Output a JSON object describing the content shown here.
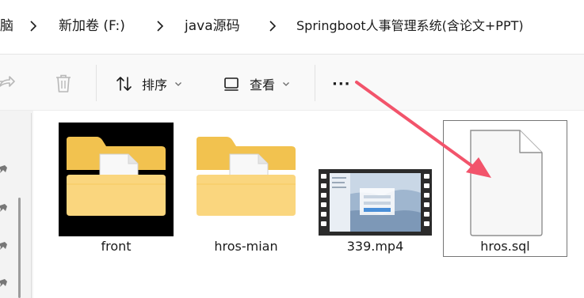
{
  "breadcrumb": {
    "items": [
      {
        "label": "脑"
      },
      {
        "label": "新加卷 (F:)"
      },
      {
        "label": "java源码"
      },
      {
        "label": "Springboot人事管理系统(含论文+PPT)"
      }
    ]
  },
  "toolbar": {
    "sort_label": "排序",
    "view_label": "查看",
    "more_label": "···"
  },
  "files": [
    {
      "name": "front",
      "type": "folder",
      "icon": "folder-icon"
    },
    {
      "name": "hros-mian",
      "type": "folder",
      "icon": "folder-icon"
    },
    {
      "name": "339.mp4",
      "type": "video",
      "icon": "video-thumbnail-icon"
    },
    {
      "name": "hros.sql",
      "type": "file",
      "icon": "file-icon",
      "selected": true
    }
  ],
  "colors": {
    "folder_back": "#f2c24f",
    "folder_front": "#fad67e",
    "arrow": "#f2546b",
    "selection_border": "#767676",
    "toolbar_bg": "#f9f9f9"
  }
}
